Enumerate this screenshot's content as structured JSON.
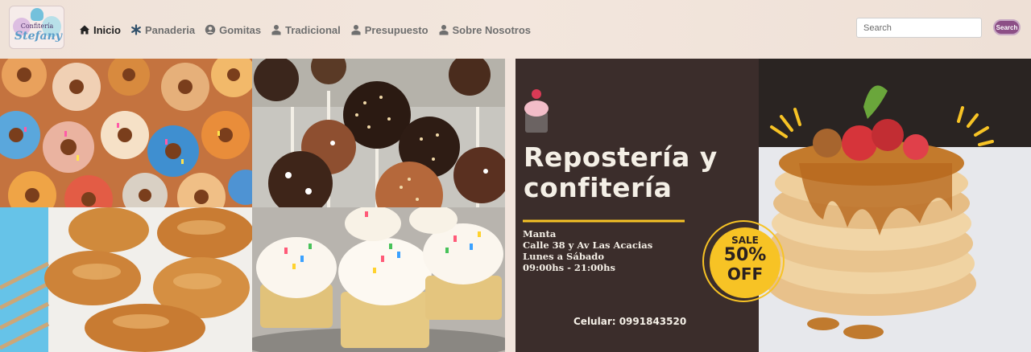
{
  "logo": {
    "line1": "Confitería",
    "line2": "Stefany"
  },
  "nav": {
    "items": [
      {
        "label": "Inicio",
        "icon": "home-icon",
        "active": true
      },
      {
        "label": "Panaderia",
        "icon": "asterisk-icon",
        "active": false
      },
      {
        "label": "Gomitas",
        "icon": "user-circle-icon",
        "active": false
      },
      {
        "label": "Tradicional",
        "icon": "user-icon",
        "active": false
      },
      {
        "label": "Presupuesto",
        "icon": "user-icon",
        "active": false
      },
      {
        "label": "Sobre Nosotros",
        "icon": "user-icon",
        "active": false
      }
    ]
  },
  "search": {
    "placeholder": "Search",
    "button_label": "Search"
  },
  "banner": {
    "title_line1": "Repostería y",
    "title_line2": "confitería",
    "city": "Manta",
    "address": "Calle 38 y Av Las Acacias",
    "days": "Lunes a Sábado",
    "hours": "09:00hs - 21:00hs",
    "phone": "Celular: 0991843520",
    "sale_word": "SALE",
    "sale_percent": "50%",
    "sale_off": "OFF"
  },
  "colors": {
    "nav_bg": "#efe2d8",
    "banner_bg": "#3b2d2b",
    "accent_yellow": "#f7c325",
    "search_button": "#8c4f86"
  }
}
